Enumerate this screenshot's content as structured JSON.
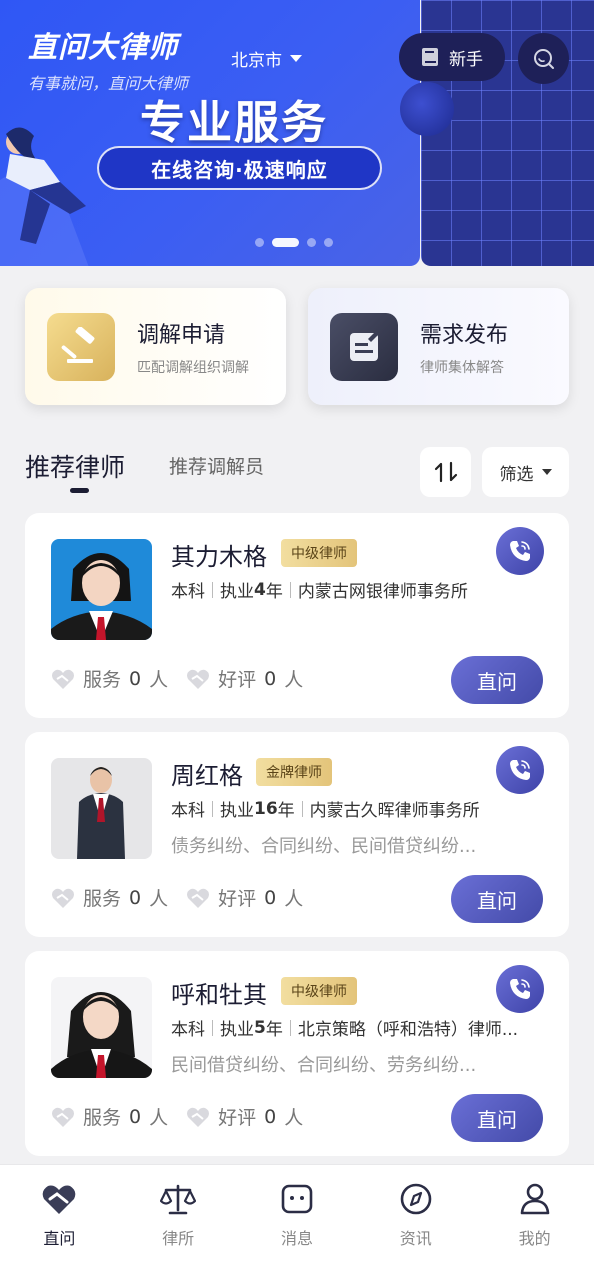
{
  "banner": {
    "app_name": "直问大律师",
    "slogan": "有事就问，直问大律师",
    "city": "北京市",
    "headline": "专业服务",
    "pill_text": "在线咨询·极速响应",
    "newbie_label": "新手",
    "slide_count": 4,
    "active_slide": 2
  },
  "quick_actions": [
    {
      "title": "调解申请",
      "subtitle": "匹配调解组织调解",
      "icon": "gavel-icon"
    },
    {
      "title": "需求发布",
      "subtitle": "律师集体解答",
      "icon": "edit-document-icon"
    }
  ],
  "tabs": {
    "active": "推荐律师",
    "other": "推荐调解员",
    "filter_label": "筛选"
  },
  "lawyers": [
    {
      "name": "其力木格",
      "level": "中级律师",
      "education": "本科",
      "years_prefix": "执业",
      "years": "4",
      "years_suffix": "年",
      "firm": "内蒙古网银律师事务所",
      "specialty": "",
      "service_label": "服务",
      "service_count": "0",
      "review_label": "好评",
      "review_count": "0",
      "unit": "人",
      "ask_label": "直问"
    },
    {
      "name": "周红格",
      "level": "金牌律师",
      "education": "本科",
      "years_prefix": "执业",
      "years": "16",
      "years_suffix": "年",
      "firm": "内蒙古久晖律师事务所",
      "specialty": "债务纠纷、合同纠纷、民间借贷纠纷...",
      "service_label": "服务",
      "service_count": "0",
      "review_label": "好评",
      "review_count": "0",
      "unit": "人",
      "ask_label": "直问"
    },
    {
      "name": "呼和牡其",
      "level": "中级律师",
      "education": "本科",
      "years_prefix": "执业",
      "years": "5",
      "years_suffix": "年",
      "firm": "北京策略（呼和浩特）律师...",
      "specialty": "民间借贷纠纷、合同纠纷、劳务纠纷...",
      "service_label": "服务",
      "service_count": "0",
      "review_label": "好评",
      "review_count": "0",
      "unit": "人",
      "ask_label": "直问"
    }
  ],
  "bottom_nav": [
    {
      "label": "直问",
      "icon": "heart-handshake-icon",
      "active": true
    },
    {
      "label": "律所",
      "icon": "scale-icon",
      "active": false
    },
    {
      "label": "消息",
      "icon": "message-icon",
      "active": false
    },
    {
      "label": "资讯",
      "icon": "compass-icon",
      "active": false
    },
    {
      "label": "我的",
      "icon": "user-icon",
      "active": false
    }
  ],
  "colors": {
    "banner_blue": "#2f57f5",
    "brand_purple": "#434aa8",
    "dark_navy": "#1e2058",
    "badge_gold": "#e3c47a"
  }
}
